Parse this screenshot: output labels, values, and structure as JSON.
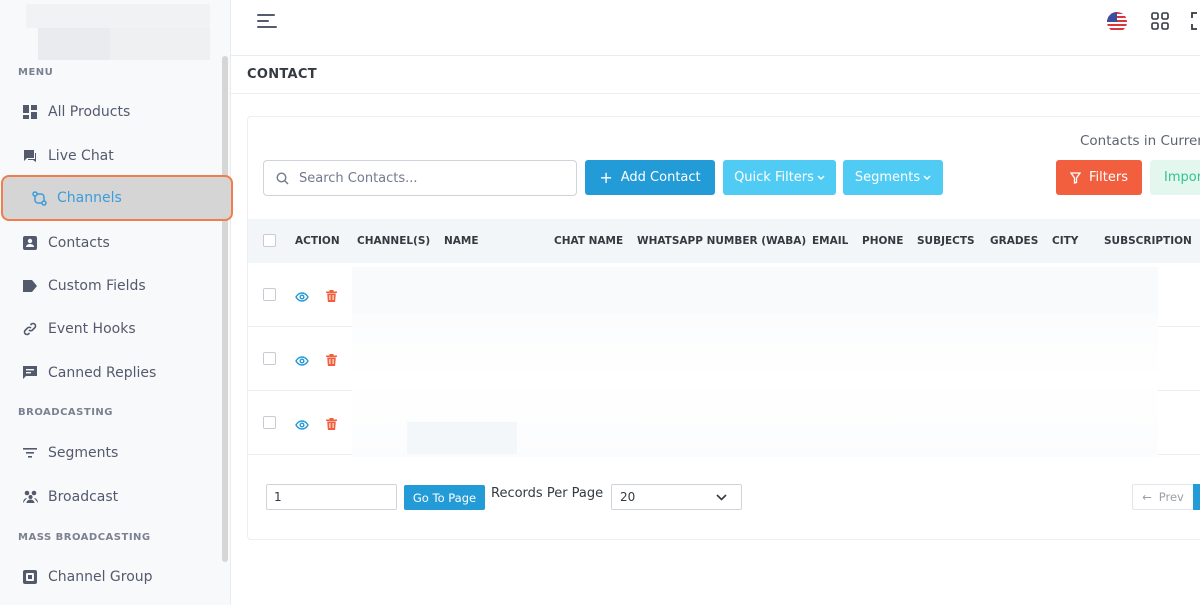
{
  "sidebar": {
    "section_menu": "MENU",
    "section_broadcasting": "BROADCASTING",
    "section_mass": "MASS BROADCASTING",
    "items": [
      {
        "label": "All Products",
        "icon": "grid-icon"
      },
      {
        "label": "Live Chat",
        "icon": "chat-icon"
      },
      {
        "label": "Channels",
        "icon": "channels-icon"
      },
      {
        "label": "Contacts",
        "icon": "contact-card-icon"
      },
      {
        "label": "Custom Fields",
        "icon": "tag-icon"
      },
      {
        "label": "Event Hooks",
        "icon": "link-icon"
      },
      {
        "label": "Canned Replies",
        "icon": "message-icon"
      },
      {
        "label": "Segments",
        "icon": "filter-lines-icon"
      },
      {
        "label": "Broadcast",
        "icon": "users-icon"
      },
      {
        "label": "Channel Group",
        "icon": "group-icon"
      }
    ],
    "active_item": "Channels"
  },
  "page": {
    "title": "CONTACT",
    "contacts_in_current": "Contacts in Curren"
  },
  "toolbar": {
    "search_placeholder": "Search Contacts...",
    "add_contact": "Add Contact",
    "quick_filters": "Quick Filters",
    "segments": "Segments",
    "filters": "Filters",
    "import": "Impor"
  },
  "table": {
    "columns": [
      "ACTION",
      "CHANNEL(S)",
      "NAME",
      "CHAT NAME",
      "WHATSAPP NUMBER (WABA)",
      "EMAIL",
      "PHONE",
      "SUBJECTS",
      "GRADES",
      "CITY",
      "SUBSCRIPTION"
    ],
    "row_count": 3
  },
  "pagination": {
    "page_value": "1",
    "go_to_page": "Go To Page",
    "records_per_page_label": "Records Per Page",
    "records_per_page_value": "20",
    "prev": "Prev"
  },
  "colors": {
    "primary": "#239bd7",
    "info": "#50ccf4",
    "danger": "#f15f3f",
    "success": "#34c38f",
    "highlight_border": "#f07d4c"
  }
}
